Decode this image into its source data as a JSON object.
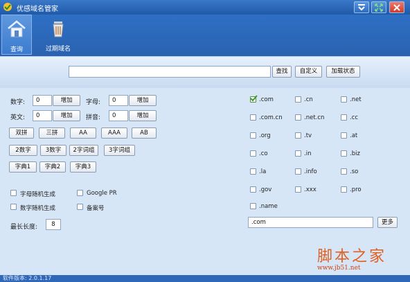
{
  "window": {
    "title": "优感域名管家",
    "colors": {
      "titlebar": "#2a66b8",
      "close": "#e6463a",
      "main_bg": "#d7e6f7"
    }
  },
  "toolbar": {
    "items": [
      {
        "label": "查询",
        "icon": "house-icon",
        "active": true
      },
      {
        "label": "过期域名",
        "icon": "trash-can-icon",
        "active": false
      }
    ]
  },
  "search": {
    "value": "",
    "find_label": "查找",
    "custom_label": "自定义",
    "load_state_label": "加载状态"
  },
  "left": {
    "digits_label": "数字:",
    "digits_value": "0",
    "letters_label": "字母:",
    "letters_value": "0",
    "english_label": "英文:",
    "english_value": "0",
    "pinyin_label": "拼音:",
    "pinyin_value": "0",
    "add_label": "增加",
    "pattern_buttons": [
      "双拼",
      "三拼",
      "AA",
      "AAA",
      "AB"
    ],
    "number_buttons": [
      "2数字",
      "3数字",
      "2字词组",
      "3字词组"
    ],
    "dict_buttons": [
      "字典1",
      "字典2",
      "字典3"
    ],
    "options": [
      {
        "label": "字母随机生成",
        "checked": false
      },
      {
        "label": "Google PR",
        "checked": false
      },
      {
        "label": "数字随机生成",
        "checked": false
      },
      {
        "label": "备案号",
        "checked": false
      }
    ],
    "max_length_label": "最长长度:",
    "max_length_value": "8"
  },
  "tlds": [
    {
      "label": ".com",
      "checked": true
    },
    {
      "label": ".cn",
      "checked": false
    },
    {
      "label": ".net",
      "checked": false
    },
    {
      "label": ".com.cn",
      "checked": false
    },
    {
      "label": ".net.cn",
      "checked": false
    },
    {
      "label": ".cc",
      "checked": false
    },
    {
      "label": ".org",
      "checked": false
    },
    {
      "label": ".tv",
      "checked": false
    },
    {
      "label": ".at",
      "checked": false
    },
    {
      "label": ".co",
      "checked": false
    },
    {
      "label": ".in",
      "checked": false
    },
    {
      "label": ".biz",
      "checked": false
    },
    {
      "label": ".la",
      "checked": false
    },
    {
      "label": ".info",
      "checked": false
    },
    {
      "label": ".so",
      "checked": false
    },
    {
      "label": ".gov",
      "checked": false
    },
    {
      "label": ".xxx",
      "checked": false
    },
    {
      "label": ".pro",
      "checked": false
    },
    {
      "label": ".name",
      "checked": false
    }
  ],
  "selected_tlds": {
    "value": ".com",
    "more_label": "更多"
  },
  "status": {
    "text": "软件版本: 2.0.1.17"
  },
  "watermark": {
    "main": "脚本之家",
    "url": "www.jb51.net"
  }
}
